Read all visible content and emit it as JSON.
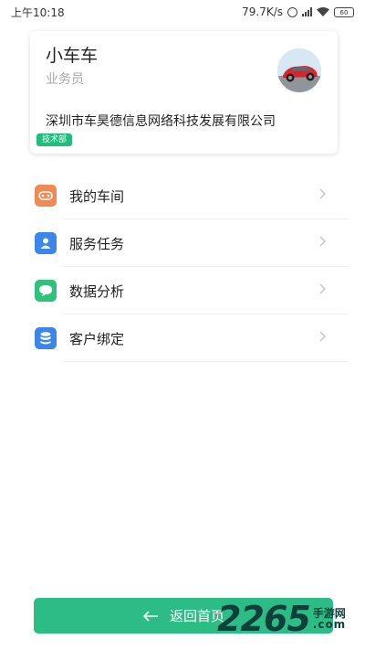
{
  "status_bar": {
    "time": "上午10:18",
    "net_speed": "79.7K/s",
    "battery": "60"
  },
  "profile": {
    "name": "小车车",
    "role": "业务员",
    "company": "深圳市车昊德信息网络科技发展有限公司",
    "department": "技术部"
  },
  "menu": [
    {
      "label": "我的车间",
      "icon": "gamepad-icon",
      "color": "#ef8a55"
    },
    {
      "label": "服务任务",
      "icon": "user-icon",
      "color": "#3b86e8"
    },
    {
      "label": "数据分析",
      "icon": "chat-icon",
      "color": "#30c27c"
    },
    {
      "label": "客户绑定",
      "icon": "database-icon",
      "color": "#3b86e8"
    }
  ],
  "home_button": {
    "label": "返回首页"
  },
  "watermark": {
    "number": "2265",
    "cn": "手游网",
    "suffix": ".com"
  }
}
